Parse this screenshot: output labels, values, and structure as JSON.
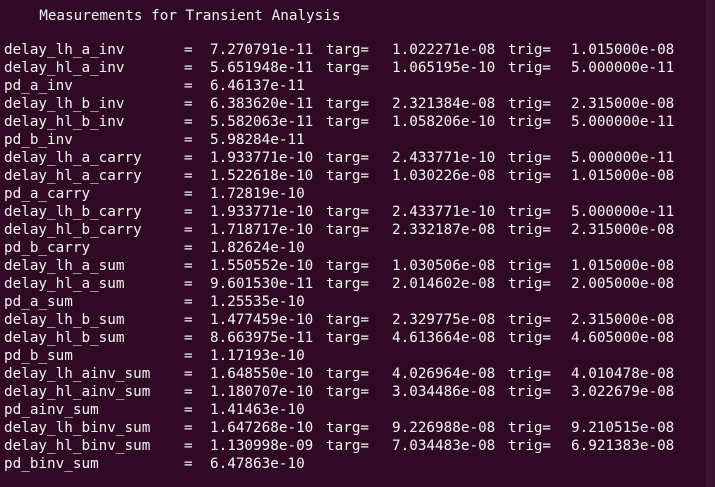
{
  "terminal": {
    "title": "  Measurements for Transient Analysis",
    "lines": [
      {
        "name": "delay_lh_a_inv",
        "eq": "=",
        "value": "7.270791e-11",
        "targ_label": "targ=",
        "targ": "1.022271e-08",
        "trig_label": "trig=",
        "trig": "1.015000e-08"
      },
      {
        "name": "delay_hl_a_inv",
        "eq": "=",
        "value": "5.651948e-11",
        "targ_label": "targ=",
        "targ": "1.065195e-10",
        "trig_label": "trig=",
        "trig": "5.000000e-11"
      },
      {
        "name": "pd_a_inv",
        "eq": "=",
        "value": "6.46137e-11",
        "targ_label": "",
        "targ": "",
        "trig_label": "",
        "trig": ""
      },
      {
        "name": "delay_lh_b_inv",
        "eq": "=",
        "value": "6.383620e-11",
        "targ_label": "targ=",
        "targ": "2.321384e-08",
        "trig_label": "trig=",
        "trig": "2.315000e-08"
      },
      {
        "name": "delay_hl_b_inv",
        "eq": "=",
        "value": "5.582063e-11",
        "targ_label": "targ=",
        "targ": "1.058206e-10",
        "trig_label": "trig=",
        "trig": "5.000000e-11"
      },
      {
        "name": "pd_b_inv",
        "eq": "=",
        "value": "5.98284e-11",
        "targ_label": "",
        "targ": "",
        "trig_label": "",
        "trig": ""
      },
      {
        "name": "delay_lh_a_carry",
        "eq": "=",
        "value": "1.933771e-10",
        "targ_label": "targ=",
        "targ": "2.433771e-10",
        "trig_label": "trig=",
        "trig": "5.000000e-11"
      },
      {
        "name": "delay_hl_a_carry",
        "eq": "=",
        "value": "1.522618e-10",
        "targ_label": "targ=",
        "targ": "1.030226e-08",
        "trig_label": "trig=",
        "trig": "1.015000e-08"
      },
      {
        "name": "pd_a_carry",
        "eq": "=",
        "value": "1.72819e-10",
        "targ_label": "",
        "targ": "",
        "trig_label": "",
        "trig": ""
      },
      {
        "name": "delay_lh_b_carry",
        "eq": "=",
        "value": "1.933771e-10",
        "targ_label": "targ=",
        "targ": "2.433771e-10",
        "trig_label": "trig=",
        "trig": "5.000000e-11"
      },
      {
        "name": "delay_hl_b_carry",
        "eq": "=",
        "value": "1.718717e-10",
        "targ_label": "targ=",
        "targ": "2.332187e-08",
        "trig_label": "trig=",
        "trig": "2.315000e-08"
      },
      {
        "name": "pd_b_carry",
        "eq": "=",
        "value": "1.82624e-10",
        "targ_label": "",
        "targ": "",
        "trig_label": "",
        "trig": ""
      },
      {
        "name": "delay_lh_a_sum",
        "eq": "=",
        "value": "1.550552e-10",
        "targ_label": "targ=",
        "targ": "1.030506e-08",
        "trig_label": "trig=",
        "trig": "1.015000e-08"
      },
      {
        "name": "delay_hl_a_sum",
        "eq": "=",
        "value": "9.601530e-11",
        "targ_label": "targ=",
        "targ": "2.014602e-08",
        "trig_label": "trig=",
        "trig": "2.005000e-08"
      },
      {
        "name": "pd_a_sum",
        "eq": "=",
        "value": "1.25535e-10",
        "targ_label": "",
        "targ": "",
        "trig_label": "",
        "trig": ""
      },
      {
        "name": "delay_lh_b_sum",
        "eq": "=",
        "value": "1.477459e-10",
        "targ_label": "targ=",
        "targ": "2.329775e-08",
        "trig_label": "trig=",
        "trig": "2.315000e-08"
      },
      {
        "name": "delay_hl_b_sum",
        "eq": "=",
        "value": "8.663975e-11",
        "targ_label": "targ=",
        "targ": "4.613664e-08",
        "trig_label": "trig=",
        "trig": "4.605000e-08"
      },
      {
        "name": "pd_b_sum",
        "eq": "=",
        "value": "1.17193e-10",
        "targ_label": "",
        "targ": "",
        "trig_label": "",
        "trig": ""
      },
      {
        "name": "delay_lh_ainv_sum",
        "eq": "=",
        "value": "1.648550e-10",
        "targ_label": "targ=",
        "targ": "4.026964e-08",
        "trig_label": "trig=",
        "trig": "4.010478e-08"
      },
      {
        "name": "delay_hl_ainv_sum",
        "eq": "=",
        "value": "1.180707e-10",
        "targ_label": "targ=",
        "targ": "3.034486e-08",
        "trig_label": "trig=",
        "trig": "3.022679e-08"
      },
      {
        "name": "pd_ainv_sum",
        "eq": "=",
        "value": "1.41463e-10",
        "targ_label": "",
        "targ": "",
        "trig_label": "",
        "trig": ""
      },
      {
        "name": "delay_lh_binv_sum",
        "eq": "=",
        "value": "1.647268e-10",
        "targ_label": "targ=",
        "targ": "9.226988e-08",
        "trig_label": "trig=",
        "trig": "9.210515e-08"
      },
      {
        "name": "delay_hl_binv_sum",
        "eq": "=",
        "value": "1.130998e-09",
        "targ_label": "targ=",
        "targ": "7.034483e-08",
        "trig_label": "trig=",
        "trig": "6.921383e-08"
      },
      {
        "name": "pd_binv_sum",
        "eq": "=",
        "value": "6.47863e-10",
        "targ_label": "",
        "targ": "",
        "trig_label": "",
        "trig": ""
      }
    ]
  },
  "colors": {
    "background": "#300a24",
    "text": "#ffffff"
  }
}
